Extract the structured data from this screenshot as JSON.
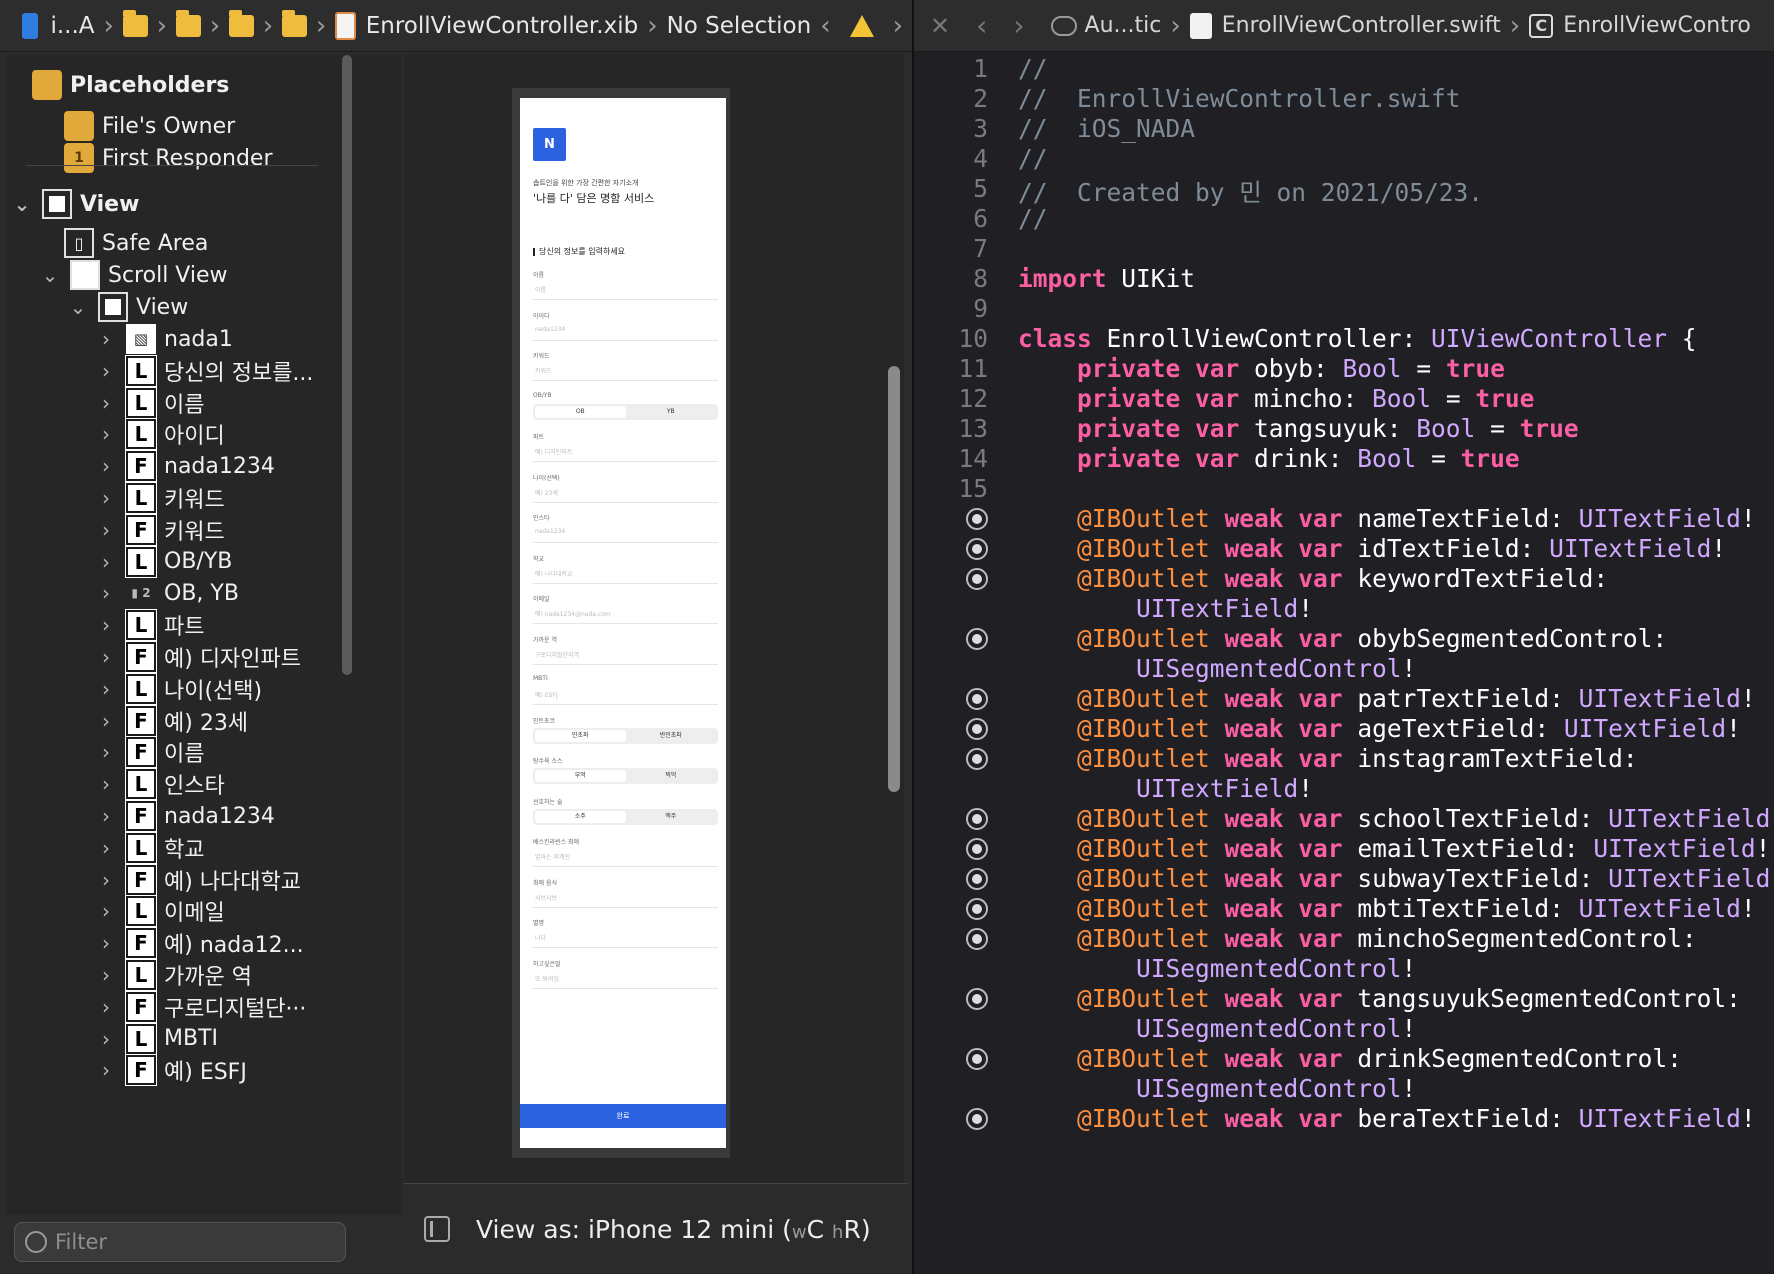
{
  "ib_jumpbar": {
    "project": "i...A",
    "file": "EnrollViewController.xib",
    "selection": "No Selection"
  },
  "outline": {
    "placeholders_title": "Placeholders",
    "files_owner": "File's Owner",
    "first_responder": "First Responder",
    "view": "View",
    "safe_area": "Safe Area",
    "scroll_view": "Scroll View",
    "inner_view": "View",
    "items": [
      {
        "icon": "I",
        "label": "nada1"
      },
      {
        "icon": "L",
        "label": "당신의 정보를..."
      },
      {
        "icon": "L",
        "label": "이름"
      },
      {
        "icon": "L",
        "label": "아이디"
      },
      {
        "icon": "F",
        "label": "nada1234"
      },
      {
        "icon": "L",
        "label": "키워드"
      },
      {
        "icon": "F",
        "label": "키워드"
      },
      {
        "icon": "L",
        "label": "OB/YB"
      },
      {
        "icon": "SEG",
        "label": "OB, YB"
      },
      {
        "icon": "L",
        "label": "파트"
      },
      {
        "icon": "F",
        "label": "예) 디자인파트"
      },
      {
        "icon": "L",
        "label": "나이(선택)"
      },
      {
        "icon": "F",
        "label": "예) 23세"
      },
      {
        "icon": "F",
        "label": "이름"
      },
      {
        "icon": "L",
        "label": "인스타"
      },
      {
        "icon": "F",
        "label": "nada1234"
      },
      {
        "icon": "L",
        "label": "학교"
      },
      {
        "icon": "F",
        "label": "예) 나다대학교"
      },
      {
        "icon": "L",
        "label": "이메일"
      },
      {
        "icon": "F",
        "label": "예) nada12..."
      },
      {
        "icon": "L",
        "label": "가까운 역"
      },
      {
        "icon": "F",
        "label": "구로디지털단···"
      },
      {
        "icon": "L",
        "label": "MBTI"
      },
      {
        "icon": "F",
        "label": "예) ESFJ"
      }
    ],
    "filter_placeholder": "Filter"
  },
  "screen": {
    "logo": "N",
    "subtitle": "솝트인을 위한 가장 간편한 자기소개",
    "title": "'나를 다' 담은 명함 서비스",
    "section": "당신의 정보를 입력하세요",
    "fields": [
      {
        "label": "이름",
        "placeholder": "이름"
      },
      {
        "label": "아이디",
        "placeholder": "nada1234"
      },
      {
        "label": "키워드",
        "placeholder": "키워드"
      },
      {
        "label": "OB/YB",
        "segments": [
          "OB",
          "YB"
        ]
      },
      {
        "label": "파트",
        "placeholder": "예) 디자인파트"
      },
      {
        "label": "나이(선택)",
        "placeholder": "예) 23세"
      },
      {
        "label": "인스타",
        "placeholder": "nada1234"
      },
      {
        "label": "학교",
        "placeholder": "예) 나다대학교"
      },
      {
        "label": "이메일",
        "placeholder": "예) nada1234@nada.com"
      },
      {
        "label": "가까운 역",
        "placeholder": "구로디지털단지역"
      },
      {
        "label": "MBTI",
        "placeholder": "예) ESFJ"
      },
      {
        "label": "민트초코",
        "segments": [
          "민초파",
          "반민초파"
        ]
      },
      {
        "label": "탕수육 소스",
        "segments": [
          "부먹",
          "찍먹"
        ]
      },
      {
        "label": "선호하는 술",
        "segments": [
          "소주",
          "맥주"
        ]
      },
      {
        "label": "베스킨라빈스 최애",
        "placeholder": "엄마는 외계인"
      },
      {
        "label": "최애 음식",
        "placeholder": "샤브샤브"
      },
      {
        "label": "별명",
        "placeholder": "나다"
      },
      {
        "label": "하고싶은말",
        "placeholder": "또 봐여잉"
      }
    ],
    "done": "완료"
  },
  "view_as": {
    "label": "View as: iPhone 12 mini (",
    "w": "w",
    "w_class": "C",
    "h": "h",
    "h_class": "R",
    "close": ")"
  },
  "code_jumpbar": {
    "scheme": "Au...tic",
    "file": "EnrollViewController.swift",
    "class": "EnrollViewContro"
  },
  "code": {
    "lines": [
      {
        "n": "1",
        "t": [
          [
            "cm",
            "//"
          ]
        ]
      },
      {
        "n": "2",
        "t": [
          [
            "cm",
            "//  EnrollViewController.swift"
          ]
        ]
      },
      {
        "n": "3",
        "t": [
          [
            "cm",
            "//  iOS_NADA"
          ]
        ]
      },
      {
        "n": "4",
        "t": [
          [
            "cm",
            "//"
          ]
        ]
      },
      {
        "n": "5",
        "t": [
          [
            "cm",
            "//  Created by 민 on 2021/05/23."
          ]
        ]
      },
      {
        "n": "6",
        "t": [
          [
            "cm",
            "//"
          ]
        ]
      },
      {
        "n": "7",
        "t": []
      },
      {
        "n": "8",
        "t": [
          [
            "kw",
            "import"
          ],
          [
            "",
            "UIKit"
          ]
        ]
      },
      {
        "n": "9",
        "t": []
      },
      {
        "n": "10",
        "t": [
          [
            "kw",
            "class"
          ],
          [
            "",
            " EnrollViewController: "
          ],
          [
            "ty",
            "UIViewController"
          ],
          [
            "",
            " {"
          ]
        ]
      },
      {
        "n": "11",
        "t": [
          [
            "",
            "    "
          ],
          [
            "kw",
            "private var"
          ],
          [
            "",
            " obyb: "
          ],
          [
            "ty",
            "Bool"
          ],
          [
            "",
            " = "
          ],
          [
            "kw",
            "true"
          ]
        ]
      },
      {
        "n": "12",
        "t": [
          [
            "",
            "    "
          ],
          [
            "kw",
            "private var"
          ],
          [
            "",
            " mincho: "
          ],
          [
            "ty",
            "Bool"
          ],
          [
            "",
            " = "
          ],
          [
            "kw",
            "true"
          ]
        ]
      },
      {
        "n": "13",
        "t": [
          [
            "",
            "    "
          ],
          [
            "kw",
            "private var"
          ],
          [
            "",
            " tangsuyuk: "
          ],
          [
            "ty",
            "Bool"
          ],
          [
            "",
            " = "
          ],
          [
            "kw",
            "true"
          ]
        ]
      },
      {
        "n": "14",
        "t": [
          [
            "",
            "    "
          ],
          [
            "kw",
            "private var"
          ],
          [
            "",
            " drink: "
          ],
          [
            "ty",
            "Bool"
          ],
          [
            "",
            " = "
          ],
          [
            "kw",
            "true"
          ]
        ]
      },
      {
        "n": "15",
        "t": []
      },
      {
        "n": "bp",
        "t": [
          [
            "",
            "    "
          ],
          [
            "at",
            "@IBOutlet"
          ],
          [
            "",
            " "
          ],
          [
            "kw",
            "weak var"
          ],
          [
            "",
            " nameTextField: "
          ],
          [
            "ty",
            "UITextField"
          ],
          [
            "",
            "!"
          ]
        ]
      },
      {
        "n": "bp",
        "t": [
          [
            "",
            "    "
          ],
          [
            "at",
            "@IBOutlet"
          ],
          [
            "",
            " "
          ],
          [
            "kw",
            "weak var"
          ],
          [
            "",
            " idTextField: "
          ],
          [
            "ty",
            "UITextField"
          ],
          [
            "",
            "!"
          ]
        ]
      },
      {
        "n": "bp",
        "t": [
          [
            "",
            "    "
          ],
          [
            "at",
            "@IBOutlet"
          ],
          [
            "",
            " "
          ],
          [
            "kw",
            "weak var"
          ],
          [
            "",
            " keywordTextField:"
          ]
        ]
      },
      {
        "n": "",
        "t": [
          [
            "",
            "        "
          ],
          [
            "ty",
            "UITextField"
          ],
          [
            "",
            "!"
          ]
        ]
      },
      {
        "n": "bp",
        "t": [
          [
            "",
            "    "
          ],
          [
            "at",
            "@IBOutlet"
          ],
          [
            "",
            " "
          ],
          [
            "kw",
            "weak var"
          ],
          [
            "",
            " obybSegmentedControl:"
          ]
        ]
      },
      {
        "n": "",
        "t": [
          [
            "",
            "        "
          ],
          [
            "ty",
            "UISegmentedControl"
          ],
          [
            "",
            "!"
          ]
        ]
      },
      {
        "n": "bp",
        "t": [
          [
            "",
            "    "
          ],
          [
            "at",
            "@IBOutlet"
          ],
          [
            "",
            " "
          ],
          [
            "kw",
            "weak var"
          ],
          [
            "",
            " patrTextField: "
          ],
          [
            "ty",
            "UITextField"
          ],
          [
            "",
            "!"
          ]
        ]
      },
      {
        "n": "bp",
        "t": [
          [
            "",
            "    "
          ],
          [
            "at",
            "@IBOutlet"
          ],
          [
            "",
            " "
          ],
          [
            "kw",
            "weak var"
          ],
          [
            "",
            " ageTextField: "
          ],
          [
            "ty",
            "UITextField"
          ],
          [
            "",
            "!"
          ]
        ]
      },
      {
        "n": "bp",
        "t": [
          [
            "",
            "    "
          ],
          [
            "at",
            "@IBOutlet"
          ],
          [
            "",
            " "
          ],
          [
            "kw",
            "weak var"
          ],
          [
            "",
            " instagramTextField:"
          ]
        ]
      },
      {
        "n": "",
        "t": [
          [
            "",
            "        "
          ],
          [
            "ty",
            "UITextField"
          ],
          [
            "",
            "!"
          ]
        ]
      },
      {
        "n": "bp",
        "t": [
          [
            "",
            "    "
          ],
          [
            "at",
            "@IBOutlet"
          ],
          [
            "",
            " "
          ],
          [
            "kw",
            "weak var"
          ],
          [
            "",
            " schoolTextField: "
          ],
          [
            "ty",
            "UITextField"
          ]
        ]
      },
      {
        "n": "bp",
        "t": [
          [
            "",
            "    "
          ],
          [
            "at",
            "@IBOutlet"
          ],
          [
            "",
            " "
          ],
          [
            "kw",
            "weak var"
          ],
          [
            "",
            " emailTextField: "
          ],
          [
            "ty",
            "UITextField"
          ],
          [
            "",
            "!"
          ]
        ]
      },
      {
        "n": "bp",
        "t": [
          [
            "",
            "    "
          ],
          [
            "at",
            "@IBOutlet"
          ],
          [
            "",
            " "
          ],
          [
            "kw",
            "weak var"
          ],
          [
            "",
            " subwayTextField: "
          ],
          [
            "ty",
            "UITextField"
          ]
        ]
      },
      {
        "n": "bp",
        "t": [
          [
            "",
            "    "
          ],
          [
            "at",
            "@IBOutlet"
          ],
          [
            "",
            " "
          ],
          [
            "kw",
            "weak var"
          ],
          [
            "",
            " mbtiTextField: "
          ],
          [
            "ty",
            "UITextField"
          ],
          [
            "",
            "!"
          ]
        ]
      },
      {
        "n": "bp",
        "t": [
          [
            "",
            "    "
          ],
          [
            "at",
            "@IBOutlet"
          ],
          [
            "",
            " "
          ],
          [
            "kw",
            "weak var"
          ],
          [
            "",
            " minchoSegmentedControl:"
          ]
        ]
      },
      {
        "n": "",
        "t": [
          [
            "",
            "        "
          ],
          [
            "ty",
            "UISegmentedControl"
          ],
          [
            "",
            "!"
          ]
        ]
      },
      {
        "n": "bp",
        "t": [
          [
            "",
            "    "
          ],
          [
            "at",
            "@IBOutlet"
          ],
          [
            "",
            " "
          ],
          [
            "kw",
            "weak var"
          ],
          [
            "",
            " tangsuyukSegmentedControl:"
          ]
        ]
      },
      {
        "n": "",
        "t": [
          [
            "",
            "        "
          ],
          [
            "ty",
            "UISegmentedControl"
          ],
          [
            "",
            "!"
          ]
        ]
      },
      {
        "n": "bp",
        "t": [
          [
            "",
            "    "
          ],
          [
            "at",
            "@IBOutlet"
          ],
          [
            "",
            " "
          ],
          [
            "kw",
            "weak var"
          ],
          [
            "",
            " drinkSegmentedControl:"
          ]
        ]
      },
      {
        "n": "",
        "t": [
          [
            "",
            "        "
          ],
          [
            "ty",
            "UISegmentedControl"
          ],
          [
            "",
            "!"
          ]
        ]
      },
      {
        "n": "bp",
        "t": [
          [
            "",
            "    "
          ],
          [
            "at",
            "@IBOutlet"
          ],
          [
            "",
            " "
          ],
          [
            "kw",
            "weak var"
          ],
          [
            "",
            " beraTextField: "
          ],
          [
            "ty",
            "UITextField"
          ],
          [
            "",
            "!"
          ]
        ]
      }
    ]
  }
}
